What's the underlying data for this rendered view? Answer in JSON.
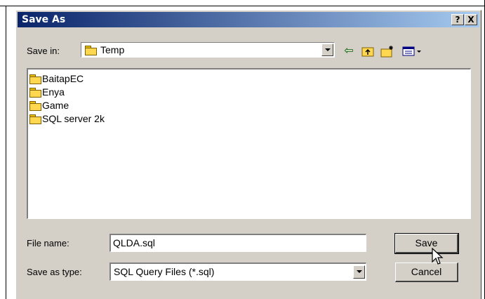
{
  "dialog": {
    "title": "Save As",
    "help_button": "?",
    "close_button": "X"
  },
  "save_in": {
    "label": "Save in:",
    "value": "Temp"
  },
  "toolbar": {
    "back_icon": "arrow-left",
    "up_icon": "folder-up",
    "new_folder_icon": "new-folder",
    "view_menu_icon": "view-menu"
  },
  "files": [
    {
      "name": "BaitapEC"
    },
    {
      "name": "Enya"
    },
    {
      "name": "Game"
    },
    {
      "name": "SQL server 2k"
    }
  ],
  "file_name": {
    "label": "File name:",
    "value": "QLDA.sql"
  },
  "save_as_type": {
    "label": "Save as type:",
    "value": "SQL Query Files (*.sql)"
  },
  "buttons": {
    "save": "Save",
    "cancel": "Cancel"
  },
  "colors": {
    "title_start": "#0a246a",
    "title_end": "#a6caf0",
    "face": "#d4d0c8",
    "folder": "#ffd850"
  }
}
